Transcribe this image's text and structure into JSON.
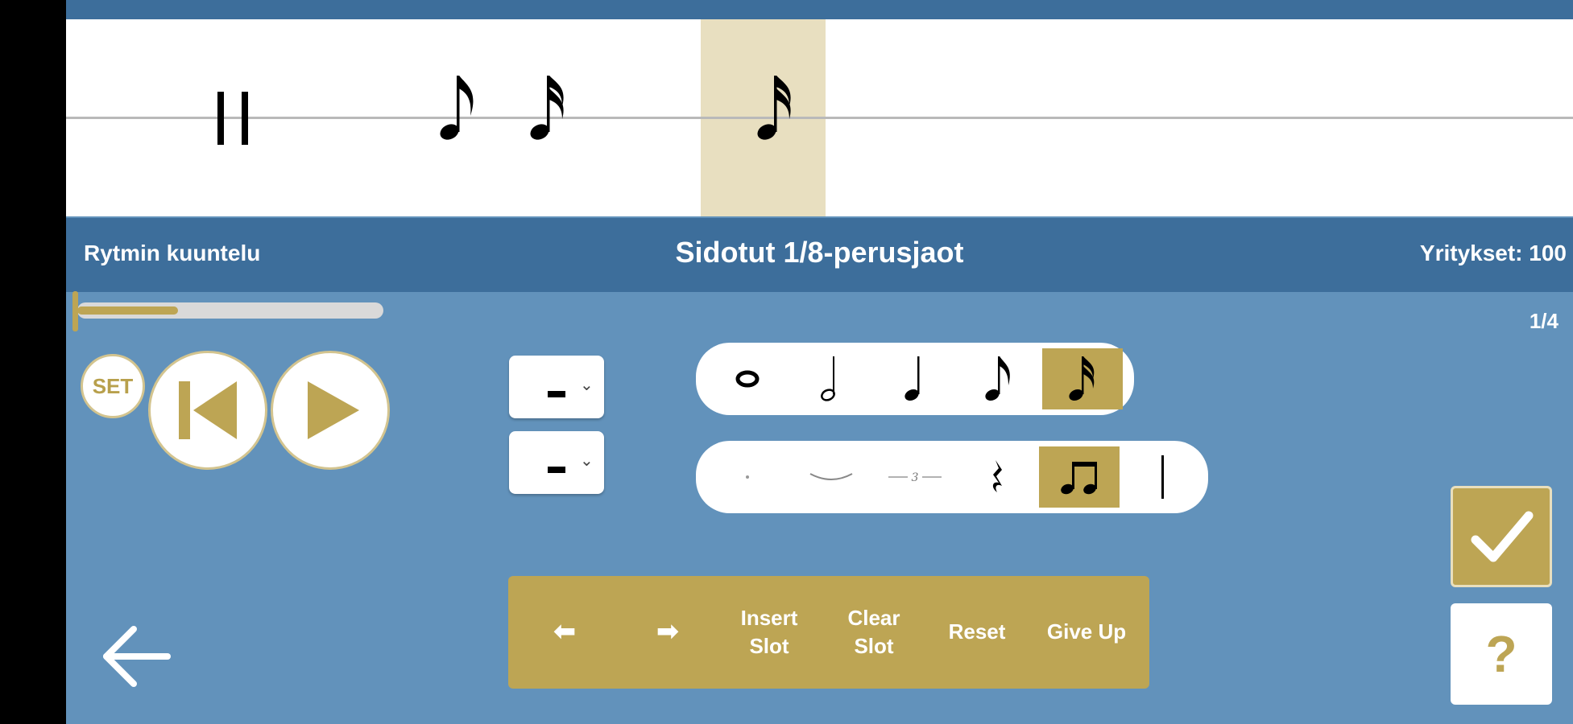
{
  "staff": {
    "symbols": [
      "bar-line",
      "eighth-note",
      "sixteenth-note",
      "sixteenth-note-selected"
    ]
  },
  "infobar": {
    "left_label": "Rytmin kuuntelu",
    "title": "Sidotut 1/8-perusjaot",
    "attempts_label": "Yritykset: 100"
  },
  "progress": {
    "value": 0.33
  },
  "counter": "1/4",
  "controls": {
    "set_label": "SET"
  },
  "note_values": {
    "dropdown_value": "-",
    "items": [
      "whole-note-icon",
      "half-note-icon",
      "quarter-note-icon",
      "eighth-note-icon",
      "sixteenth-note-icon"
    ],
    "selected": "sixteenth-note-icon"
  },
  "modifiers": {
    "dropdown_value": "-",
    "items": [
      "dot-icon",
      "tie-icon",
      "triplet-icon",
      "rest-icon",
      "beamed-notes-icon",
      "bar-line-icon"
    ],
    "selected": "beamed-notes-icon"
  },
  "toolbar": {
    "prev_label": "⬅",
    "next_label": "➡",
    "insert_label": "Insert\nSlot",
    "clear_label": "Clear\nSlot",
    "reset_label": "Reset",
    "giveup_label": "Give Up"
  },
  "help_label": "?",
  "colors": {
    "accent": "#bda554",
    "panel": "#6292bb",
    "bar": "#3d6e9b",
    "highlight": "#e8dfc0"
  }
}
